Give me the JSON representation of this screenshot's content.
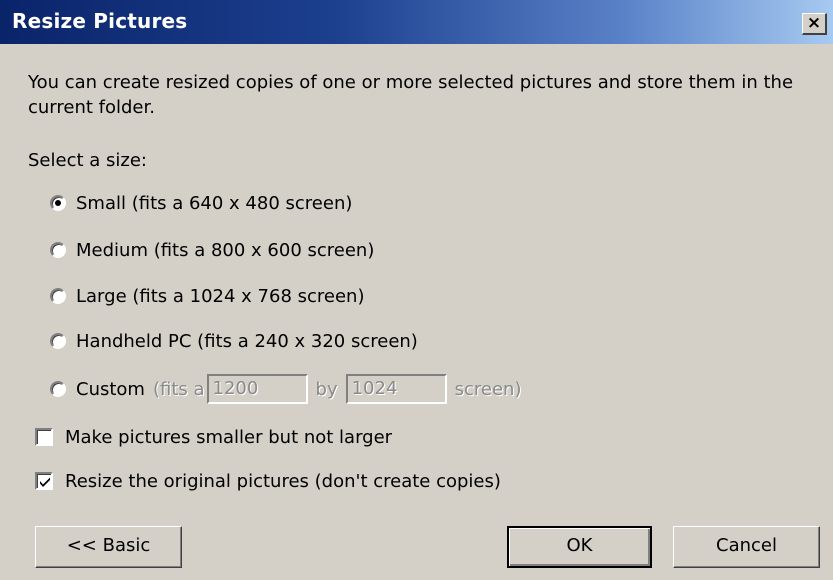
{
  "window": {
    "title": "Resize Pictures",
    "close_label": "×"
  },
  "description": "You can create resized copies of one or more selected pictures and store them in the current folder.",
  "select_label": "Select a size:",
  "size_options": [
    {
      "label": "Small (fits a 640 x 480 screen)",
      "checked": true
    },
    {
      "label": "Medium (fits a 800 x 600 screen)",
      "checked": false
    },
    {
      "label": "Large (fits a 1024 x 768 screen)",
      "checked": false
    },
    {
      "label": "Handheld PC (fits a 240 x 320 screen)",
      "checked": false
    }
  ],
  "custom": {
    "label": "Custom",
    "prefix": "(fits a",
    "width_value": "1200",
    "by": "by",
    "height_value": "1024",
    "suffix": "screen)"
  },
  "options": {
    "smaller_only": {
      "label": "Make pictures smaller but not larger",
      "checked": false
    },
    "resize_original": {
      "label": "Resize the original pictures (don't create copies)",
      "checked": true
    }
  },
  "buttons": {
    "basic": "<< Basic",
    "ok": "OK",
    "cancel": "Cancel"
  }
}
